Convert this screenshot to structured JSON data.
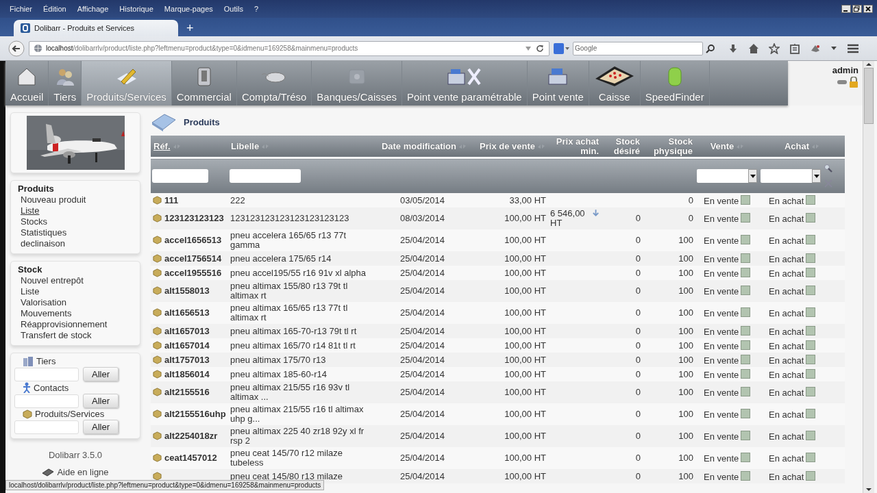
{
  "browser": {
    "menu": [
      "Fichier",
      "Édition",
      "Affichage",
      "Historique",
      "Marque-pages",
      "Outils",
      "?"
    ],
    "tab": {
      "title": "Dolibarr - Produits et Services",
      "selected": true
    },
    "new_tab": "+",
    "url_host": "localhost",
    "url_path": "/dolibarrlv/product/liste.php?leftmenu=product&type=0&idmenu=169258&mainmenu=products",
    "search_placeholder": "Google"
  },
  "top_menu": [
    {
      "label": "Accueil",
      "selected": false
    },
    {
      "label": "Tiers",
      "selected": false
    },
    {
      "label": "Produits/Services",
      "selected": true
    },
    {
      "label": "Commercial",
      "selected": false
    },
    {
      "label": "Compta/Tréso",
      "selected": false
    },
    {
      "label": "Banques/Caisses",
      "selected": false
    },
    {
      "label": "Point vente paramétrable",
      "selected": false
    },
    {
      "label": "Point vente",
      "selected": false
    },
    {
      "label": "Caisse",
      "selected": false
    },
    {
      "label": "SpeedFinder",
      "selected": false
    }
  ],
  "user": "admin",
  "sidebar": {
    "blocks": [
      {
        "title": "Produits",
        "items": [
          {
            "label": "Nouveau produit",
            "hovered": false
          },
          {
            "label": "Liste",
            "hovered": true
          },
          {
            "label": "Stocks",
            "hovered": false
          },
          {
            "label": "Statistiques",
            "hovered": false
          },
          {
            "label": "declinaison",
            "hovered": false
          }
        ]
      },
      {
        "title": "Stock",
        "items": [
          {
            "label": "Nouvel entrepôt",
            "hovered": false
          },
          {
            "label": "Liste",
            "hovered": false
          },
          {
            "label": "Valorisation",
            "hovered": false
          },
          {
            "label": "Mouvements",
            "hovered": false
          },
          {
            "label": "Réapprovisionnement",
            "hovered": false
          },
          {
            "label": "Transfert de stock",
            "hovered": false
          }
        ]
      }
    ],
    "searches": [
      {
        "label": "Tiers",
        "button": "Aller"
      },
      {
        "label": "Contacts",
        "button": "Aller"
      },
      {
        "label": "Produits/Services",
        "button": "Aller"
      }
    ],
    "version": "Dolibarr 3.5.0",
    "help": "Aide en ligne"
  },
  "page_title": "Produits",
  "table": {
    "columns": [
      {
        "label": "Réf.",
        "sortable": true,
        "sorted": true
      },
      {
        "label": "Libelle",
        "sortable": true,
        "sorted": false
      },
      {
        "label": "Date modification",
        "sortable": true,
        "sorted": false
      },
      {
        "label": "Prix de vente",
        "sortable": true,
        "sorted": false
      },
      {
        "label": "Prix achat min.",
        "sortable": false,
        "sorted": false
      },
      {
        "label": "Stock désiré",
        "sortable": false,
        "sorted": false
      },
      {
        "label": "Stock physique",
        "sortable": false,
        "sorted": false
      },
      {
        "label": "Vente",
        "sortable": true,
        "sorted": false
      },
      {
        "label": "Achat",
        "sortable": true,
        "sorted": false
      }
    ],
    "rows": [
      {
        "ref": "111",
        "label": "222",
        "date": "03/05/2014",
        "price": "33,00 HT",
        "stock_physical": "0",
        "sale": "En vente",
        "on_sale": true,
        "purchase": "En achat",
        "on_purchase": true
      },
      {
        "ref": "123123123123",
        "label": "123123123123123123123123",
        "date": "08/03/2014",
        "price": "100,00 HT",
        "min_buy_price": "6 546,00 HT",
        "stock_desired": "0",
        "stock_physical": "0",
        "sale": "En vente",
        "on_sale": true,
        "purchase": "En achat",
        "on_purchase": true
      },
      {
        "ref": "accel1656513",
        "label": "pneu accelera 165/65 r13 77t gamma",
        "date": "25/04/2014",
        "price": "100,00 HT",
        "stock_desired": "0",
        "stock_physical": "100",
        "sale": "En vente",
        "on_sale": true,
        "purchase": "En achat",
        "on_purchase": true
      },
      {
        "ref": "accel1756514",
        "label": "pneu accelera 175/65 r14",
        "date": "25/04/2014",
        "price": "100,00 HT",
        "stock_desired": "0",
        "stock_physical": "100",
        "sale": "En vente",
        "on_sale": true,
        "purchase": "En achat",
        "on_purchase": true
      },
      {
        "ref": "accel1955516",
        "label": "pneu accel195/55 r16 91v xl alpha",
        "date": "25/04/2014",
        "price": "100,00 HT",
        "stock_desired": "0",
        "stock_physical": "100",
        "sale": "En vente",
        "on_sale": true,
        "purchase": "En achat",
        "on_purchase": true
      },
      {
        "ref": "alt1558013",
        "label": "pneu altimax 155/80 r13 79t tl altimax rt",
        "date": "25/04/2014",
        "price": "100,00 HT",
        "stock_desired": "0",
        "stock_physical": "100",
        "sale": "En vente",
        "on_sale": true,
        "purchase": "En achat",
        "on_purchase": true
      },
      {
        "ref": "alt1656513",
        "label": "pneu altimax 165/65 r13 77t tl altimax rt",
        "date": "25/04/2014",
        "price": "100,00 HT",
        "stock_desired": "0",
        "stock_physical": "100",
        "sale": "En vente",
        "on_sale": true,
        "purchase": "En achat",
        "on_purchase": true
      },
      {
        "ref": "alt1657013",
        "label": "pneu altimax 165-70-r13 79t tl rt",
        "date": "25/04/2014",
        "price": "100,00 HT",
        "stock_desired": "0",
        "stock_physical": "100",
        "sale": "En vente",
        "on_sale": true,
        "purchase": "En achat",
        "on_purchase": true
      },
      {
        "ref": "alt1657014",
        "label": "pneu altimax 165/70 r14 81t tl rt",
        "date": "25/04/2014",
        "price": "100,00 HT",
        "stock_desired": "0",
        "stock_physical": "100",
        "sale": "En vente",
        "on_sale": true,
        "purchase": "En achat",
        "on_purchase": true
      },
      {
        "ref": "alt1757013",
        "label": "pneu altimax 175/70 r13",
        "date": "25/04/2014",
        "price": "100,00 HT",
        "stock_desired": "0",
        "stock_physical": "100",
        "sale": "En vente",
        "on_sale": true,
        "purchase": "En achat",
        "on_purchase": true
      },
      {
        "ref": "alt1856014",
        "label": "pneu altimax 185-60-r14",
        "date": "25/04/2014",
        "price": "100,00 HT",
        "stock_desired": "0",
        "stock_physical": "100",
        "sale": "En vente",
        "on_sale": true,
        "purchase": "En achat",
        "on_purchase": true
      },
      {
        "ref": "alt2155516",
        "label": "pneu altimax 215/55 r16 93v tl altimax ...",
        "date": "25/04/2014",
        "price": "100,00 HT",
        "stock_desired": "0",
        "stock_physical": "100",
        "sale": "En vente",
        "on_sale": true,
        "purchase": "En achat",
        "on_purchase": true
      },
      {
        "ref": "alt2155516uhp",
        "label": "pneu altimax 215/55 r16 tl altimax uhp g...",
        "date": "25/04/2014",
        "price": "100,00 HT",
        "stock_desired": "0",
        "stock_physical": "100",
        "sale": "En vente",
        "on_sale": true,
        "purchase": "En achat",
        "on_purchase": true
      },
      {
        "ref": "alt2254018zr",
        "label": "pneu altimax 225 40 zr18 92y xl fr rsp 2",
        "date": "25/04/2014",
        "price": "100,00 HT",
        "stock_desired": "0",
        "stock_physical": "100",
        "sale": "En vente",
        "on_sale": true,
        "purchase": "En achat",
        "on_purchase": true
      },
      {
        "ref": "ceat1457012",
        "label": "pneu ceat 145/70 r12 milaze tubeless",
        "date": "25/04/2014",
        "price": "100,00 HT",
        "stock_desired": "0",
        "stock_physical": "100",
        "sale": "En vente",
        "on_sale": true,
        "purchase": "En achat",
        "on_purchase": true
      },
      {
        "label": "pneu ceat 145/80 r13 milaze",
        "date": "25/04/2014",
        "price": "100,00 HT",
        "stock_desired": "0",
        "stock_physical": "100",
        "sale": "En vente",
        "on_sale": true,
        "purchase": "En achat",
        "on_purchase": true
      }
    ]
  },
  "status_url": "localhost/dolibarrlv/product/liste.php?leftmenu=product&type=0&idmenu=169258&mainmenu=products"
}
